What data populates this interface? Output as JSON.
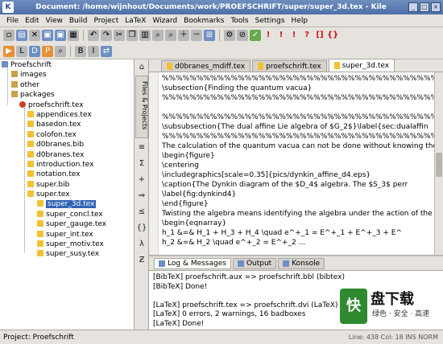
{
  "window": {
    "title": "Document: /home/wijnhout/Documents/work/PROEFSCHRIFT/super/super_3d.tex - Kile",
    "app_icon": "K"
  },
  "menu": [
    "File",
    "Edit",
    "View",
    "Build",
    "Project",
    "LaTeX",
    "Wizard",
    "Bookmarks",
    "Tools",
    "Settings",
    "Help"
  ],
  "toolbar": {
    "row1_icons": [
      "new-file-icon",
      "open-icon",
      "close-icon",
      "save-icon",
      "save-all-icon",
      "print-icon",
      "undo-icon",
      "redo-icon",
      "cut-icon",
      "copy-icon",
      "paste-icon"
    ],
    "row2_icons": [
      "quickbuild-icon",
      "latex-icon",
      "view-dvi-icon",
      "view-pdf-icon",
      "search-icon"
    ]
  },
  "sidebar": {
    "vertical_tab": "Files & Projects",
    "tree": [
      {
        "label": "Proefschrift",
        "type": "root"
      },
      {
        "label": "images",
        "type": "folder"
      },
      {
        "label": "other",
        "type": "folder"
      },
      {
        "label": "packages",
        "type": "folder"
      },
      {
        "label": "proefschrift.tex",
        "type": "proj"
      },
      {
        "label": "appendices.tex",
        "type": "file"
      },
      {
        "label": "basedon.tex",
        "type": "file"
      },
      {
        "label": "colofon.tex",
        "type": "file"
      },
      {
        "label": "d0branes.bib",
        "type": "file"
      },
      {
        "label": "d0branes.tex",
        "type": "file"
      },
      {
        "label": "introduction.tex",
        "type": "file"
      },
      {
        "label": "notation.tex",
        "type": "file"
      },
      {
        "label": "super.bib",
        "type": "file"
      },
      {
        "label": "super.tex",
        "type": "file"
      },
      {
        "label": "super_3d.tex",
        "type": "file"
      },
      {
        "label": "super_concl.tex",
        "type": "file"
      },
      {
        "label": "super_gauge.tex",
        "type": "file"
      },
      {
        "label": "super_int.tex",
        "type": "file"
      },
      {
        "label": "super_motiv.tex",
        "type": "file"
      },
      {
        "label": "super_susy.tex",
        "type": "file"
      }
    ]
  },
  "tabs": [
    "d0branes_mdiff.tex",
    "proefschrift.tex",
    "super_3d.tex"
  ],
  "editor": {
    "lines": [
      "%%%%%%%%%%%%%%%%%%%%%%%%%%%%%%%%%%%%%%%%%%%%%%%%%%%%%%",
      "\\subsection{Finding the quantum vacua}",
      "%%%%%%%%%%%%%%%%%%%%%%%%%%%%%%%%%%%%%%%%%%%%%%%%%%%%%%",
      "",
      "%%%%%%%%%%%%%%%%%%%%%%%%%%%%%%%%%%%%%%%%%%%%%%%%%%%%%%",
      "\\subsubsection{The dual affine Lie algebra of $G_2$}\\label{sec:dualaffin",
      "%%%%%%%%%%%%%%%%%%%%%%%%%%%%%%%%%%%%%%%%%%%%%%%%%%%%%%",
      "The calculation of the quantum vacua can not be done without knowing the",
      "\\begin{figure}",
      "    \\centering",
      "    \\includegraphics[scale=0.35]{pics/dynkin_affine_d4.eps}",
      "    \\caption{The Dynkin diagram of the $D_4$ algebra. The $S_3$ perr",
      "    \\label{fig:dynkind4}",
      "\\end{figure}",
      "Twisting the algebra means identifying the algebra under the action of the",
      "\\begin{eqnarray}",
      "    h_1 &=& H_1 + H_3 + H_4 \\quad e^+_1 = E^+_1 + E^+_3 + E^",
      "    h_2 &=& H_2 \\quad e^+_2 = E^+_2 ..."
    ]
  },
  "log": {
    "tabs": [
      "Log & Messages",
      "Output",
      "Konsole"
    ],
    "lines": [
      "[BibTeX] proefschrift.aux => proefschrift.bbl (bibtex)",
      "[BibTeX] Done!",
      "",
      "[LaTeX] proefschrift.tex => proefschrift.dvi (LaTeX)",
      "[LaTeX] 0 errors, 2 warnings, 16 badboxes",
      "[LaTeX] Done!"
    ]
  },
  "status": {
    "project": "Project: Proefschrift",
    "position": "Line: 438 Col: 18  INS  NORM"
  },
  "watermark": {
    "logo": "快",
    "title": "盘下载",
    "subtitle": "绿色 · 安全 · 高速"
  }
}
